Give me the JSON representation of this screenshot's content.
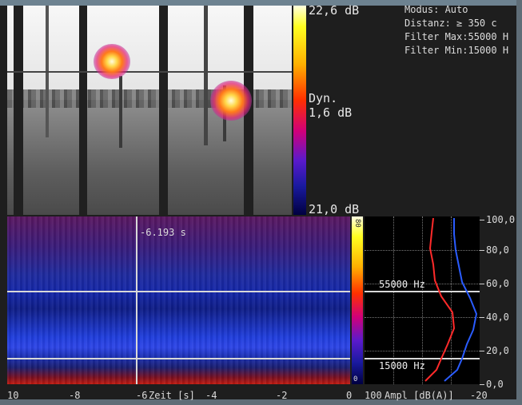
{
  "colorbar": {
    "max_label": "22,6 dB",
    "dyn_label": "Dyn.",
    "dyn_value": "1,6 dB",
    "min_label": "21,0 dB"
  },
  "info": {
    "lines": [
      "Modus:     Auto",
      "Distanz:   ≥ 350 c",
      "Filter Max:55000 H",
      "Filter Min:15000 H"
    ]
  },
  "spectrogram": {
    "cursor_time": "-6.193 s",
    "filter_max_label": "55000 Hz",
    "filter_min_label": "15000 Hz"
  },
  "time_axis": {
    "ticks": [
      "10",
      "-8",
      "-6",
      "-4",
      "-2",
      "0"
    ],
    "label": "Zeit [s]"
  },
  "amp_bar": {
    "top_label": "80",
    "bottom_label": "0"
  },
  "amp_axis": {
    "left": "100",
    "label": "Ampl [dB(A)]",
    "right": "-20"
  },
  "freq_axis": {
    "ticks": [
      "100,0",
      "80,0",
      "60,0",
      "40,0",
      "20,0",
      "0,0"
    ]
  },
  "colors": {
    "series_red": "#ff2a2a",
    "series_blue": "#2a5cff",
    "grid": "#d8d8d8"
  }
}
